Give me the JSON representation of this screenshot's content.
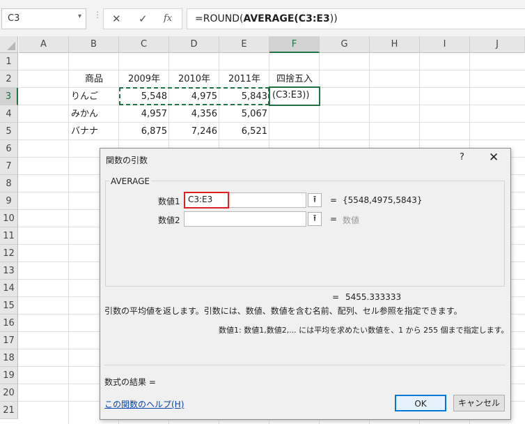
{
  "formula_bar": {
    "name_box": "C3",
    "dropdown_icon": "▾",
    "dots": "⋮",
    "cancel_icon": "✕",
    "enter_icon": "✓",
    "fx_icon": "fx",
    "formula_prefix": "=ROUND(",
    "formula_bold": "AVERAGE(C3:E3",
    "formula_suffix": "))"
  },
  "columns": [
    "A",
    "B",
    "C",
    "D",
    "E",
    "F",
    "G",
    "H",
    "I",
    "J"
  ],
  "rows": [
    "1",
    "2",
    "3",
    "4",
    "5",
    "6",
    "7",
    "8",
    "9",
    "10",
    "11",
    "12",
    "13",
    "14",
    "15",
    "16",
    "17",
    "18",
    "19",
    "20",
    "21"
  ],
  "sheet": {
    "header": {
      "product": "商品",
      "y2009": "2009年",
      "y2010": "2010年",
      "y2011": "2011年",
      "round": "四捨五入"
    },
    "r3": {
      "name": "りんご",
      "c": "5,548",
      "d": "4,975",
      "e": "5,843",
      "f": "(C3:E3))"
    },
    "r4": {
      "name": "みかん",
      "c": "4,957",
      "d": "4,356",
      "e": "5,067"
    },
    "r5": {
      "name": "バナナ",
      "c": "6,875",
      "d": "7,246",
      "e": "6,521"
    }
  },
  "dialog": {
    "title": "関数の引数",
    "help_btn": "?",
    "close_btn": "✕",
    "function_name": "AVERAGE",
    "arg1_label": "数値1",
    "arg1_value": "C3:E3",
    "arg1_result": "{5548,4975,5843}",
    "arg2_label": "数値2",
    "arg2_value": "",
    "arg2_result": "数値",
    "collapse_icon": "⭱",
    "eq": "=",
    "result": "5455.333333",
    "description": "引数の平均値を返します。引数には、数値、数値を含む名前、配列、セル参照を指定できます。",
    "arg_description": "数値1:  数値1,数値2,... には平均を求めたい数値を、1 から 255 個まで指定します。",
    "formula_result": "数式の結果 =",
    "help_link": "この関数のヘルプ(H)",
    "ok": "OK",
    "cancel": "キャンセル"
  }
}
